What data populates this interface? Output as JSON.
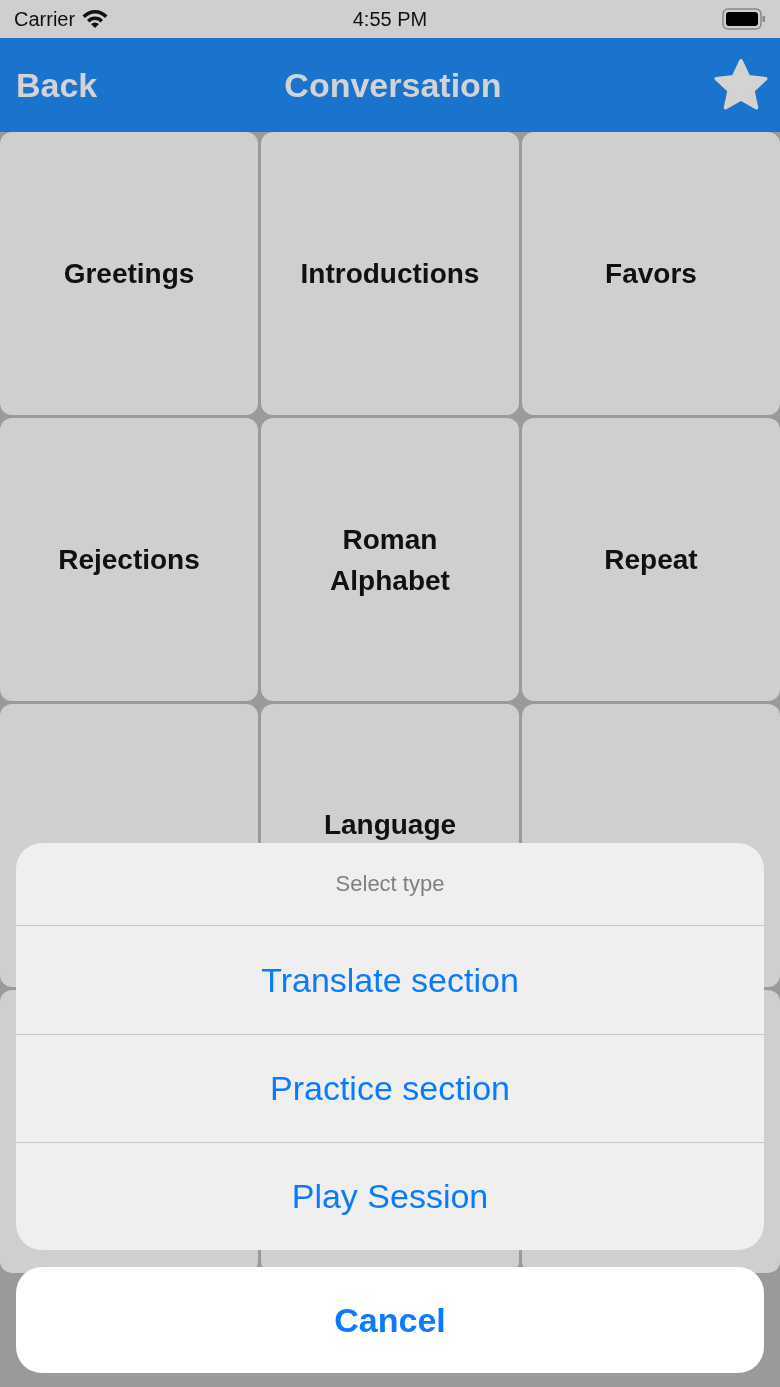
{
  "status_bar": {
    "carrier": "Carrier",
    "time": "4:55 PM"
  },
  "nav": {
    "back": "Back",
    "title": "Conversation"
  },
  "tiles": [
    {
      "kind": "open",
      "lines": [
        "Greetings"
      ]
    },
    {
      "kind": "open",
      "lines": [
        "Introductions"
      ]
    },
    {
      "kind": "open",
      "lines": [
        "Favors"
      ]
    },
    {
      "kind": "open",
      "lines": [
        "Rejections"
      ]
    },
    {
      "kind": "open",
      "lines": [
        "Roman",
        "Alphabet"
      ]
    },
    {
      "kind": "open",
      "lines": [
        "Repeat"
      ]
    },
    {
      "kind": "covered"
    },
    {
      "kind": "half_covered",
      "lines": [
        "Language"
      ]
    },
    {
      "kind": "covered"
    },
    {
      "kind": "covered"
    },
    {
      "kind": "covered"
    },
    {
      "kind": "covered"
    }
  ],
  "action_sheet": {
    "title": "Select type",
    "actions": [
      "Translate section",
      "Practice section",
      "Play Session"
    ],
    "cancel": "Cancel"
  }
}
